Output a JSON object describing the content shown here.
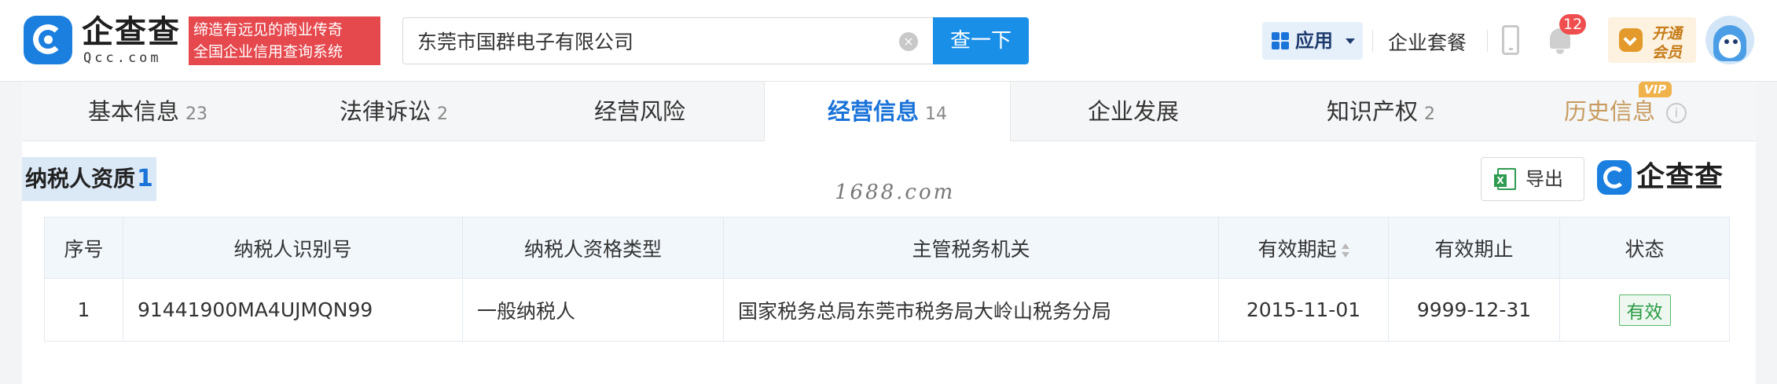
{
  "header": {
    "logo_cn": "企查查",
    "logo_en": "Qcc.com",
    "slogan_line1": "缔造有远见的商业传奇",
    "slogan_line2": "全国企业信用查询系统",
    "search_value": "东莞市国群电子有限公司",
    "search_button": "查一下",
    "app_label": "应用",
    "package_label": "企业套餐",
    "notification_count": "12",
    "vip_line1": "开通",
    "vip_line2": "会员"
  },
  "tabs": [
    {
      "label": "基本信息",
      "count": "23"
    },
    {
      "label": "法律诉讼",
      "count": "2"
    },
    {
      "label": "经营风险",
      "count": ""
    },
    {
      "label": "经营信息",
      "count": "14",
      "active": true
    },
    {
      "label": "企业发展",
      "count": ""
    },
    {
      "label": "知识产权",
      "count": "2"
    },
    {
      "label": "历史信息",
      "count": "",
      "vip": "VIP"
    }
  ],
  "section": {
    "title": "纳税人资质",
    "count": "1",
    "watermark": "1688.com",
    "export_label": "导出",
    "brand": "企查查"
  },
  "table": {
    "headers": [
      "序号",
      "纳税人识别号",
      "纳税人资格类型",
      "主管税务机关",
      "有效期起",
      "有效期止",
      "状态"
    ],
    "rows": [
      [
        "1",
        "91441900MA4UJMQN99",
        "一般纳税人",
        "国家税务总局东莞市税务局大岭山税务分局",
        "2015-11-01",
        "9999-12-31",
        "有效"
      ]
    ]
  },
  "colors": {
    "accent": "#1a73d9",
    "search_button": "#1a8fe8",
    "slogan_bg": "#e5484d",
    "status_green": "#2b9b45",
    "history_tab": "#c79b5f"
  }
}
